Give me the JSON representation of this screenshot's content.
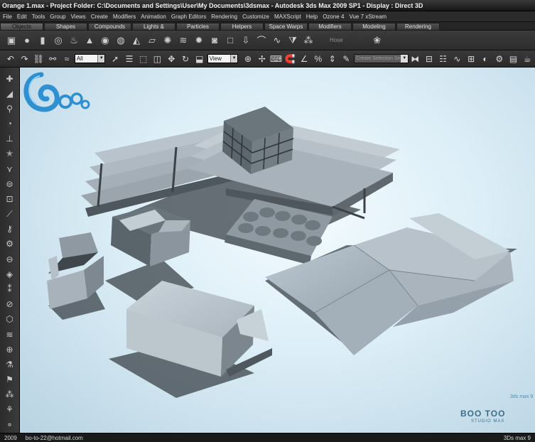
{
  "window": {
    "title": "Orange 1.max   - Project Folder: C:\\Documents and Settings\\User\\My Documents\\3dsmax   - Autodesk 3ds Max  2009 SP1   - Display : Direct 3D"
  },
  "menu": [
    "File",
    "Edit",
    "Tools",
    "Group",
    "Views",
    "Create",
    "Modifiers",
    "Animation",
    "Graph Editors",
    "Rendering",
    "Customize",
    "MAXScript",
    "Help",
    "Ozone 4",
    "Vue 7 xStream"
  ],
  "tabs": [
    "Objects",
    "Shapes",
    "Compounds",
    "Lights & Cameras",
    "Particles",
    "Helpers",
    "Space Warps",
    "Modifiers",
    "Modeling",
    "Rendering"
  ],
  "active_tab": "Objects",
  "shelf": {
    "icons": [
      "box-icon",
      "sphere-icon",
      "cylinder-icon",
      "torus-icon",
      "teapot-icon",
      "cone-icon",
      "geosphere-icon",
      "tube-icon",
      "pyramid-icon",
      "plane-icon",
      "spray-icon",
      "wind-icon",
      "light-icon",
      "camera-icon",
      "dummy-icon",
      "gravity-icon",
      "bend-icon",
      "twist-icon",
      "taper-icon",
      "noise-icon",
      "render-icon"
    ],
    "hose_label": "Hose"
  },
  "toolbar": {
    "filter_value": "All",
    "coord_value": "View",
    "selection_set_placeholder": "Create Selection Se"
  },
  "left_tools": [
    "create-icon",
    "modify-icon",
    "hierarchy-icon",
    "motion-icon",
    "display-icon",
    "utilities-icon",
    "snap-icon",
    "angle-snap-icon",
    "percent-snap-icon",
    "spinner-snap-icon",
    "named-sel-icon",
    "mirror-icon",
    "align-icon",
    "layer-icon",
    "curve-editor-icon",
    "schematic-icon",
    "material-icon",
    "render-setup-icon",
    "render-icon",
    "quick-render-icon",
    "light-lister-icon",
    "particle-icon",
    "cloth-icon",
    "hair-icon",
    "script-icon",
    "reactor-icon"
  ],
  "watermark": {
    "text": "BOO TOO",
    "sub": "STUDIO MAX",
    "version": "3ds max 9"
  },
  "status": {
    "year": "2009",
    "email": "bo-to-22@hotmail.com",
    "app": "3Ds max 9"
  }
}
